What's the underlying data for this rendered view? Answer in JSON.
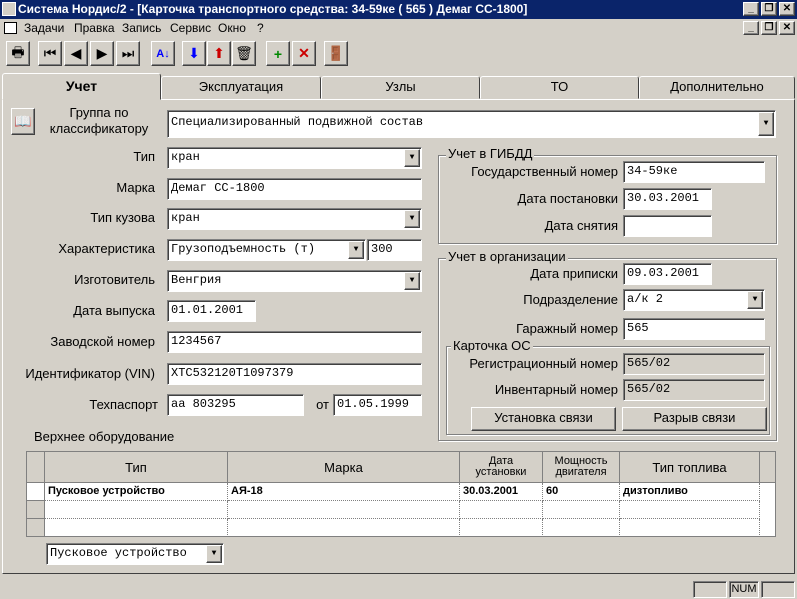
{
  "window": {
    "title": "Система Нордис/2 - [Карточка транспортного средства: 34-59ке ( 565 )  Демаг CC-1800]"
  },
  "menu": [
    "Задачи",
    "Правка",
    "Запись",
    "Сервис",
    "Окно",
    "?"
  ],
  "tabs": [
    "Учет",
    "Эксплуатация",
    "Узлы",
    "ТО",
    "Дополнительно"
  ],
  "form": {
    "group_label": "Группа по\nклассификатору",
    "group_value": "Специализированный подвижной состав",
    "type_label": "Тип",
    "type_value": "кран",
    "brand_label": "Марка",
    "brand_value": "Демаг CC-1800",
    "body_label": "Тип кузова",
    "body_value": "кран",
    "char_label": "Характеристика",
    "char_value": "Грузоподъемность (т)",
    "char_num": "300",
    "maker_label": "Изготовитель",
    "maker_value": "Венгрия",
    "release_label": "Дата выпуска",
    "release_value": "01.01.2001",
    "factory_label": "Заводской номер",
    "factory_value": "1234567",
    "vin_label": "Идентификатор (VIN)",
    "vin_value": "XTC532120T1097379",
    "passport_label": "Техпаспорт",
    "passport_value": "аа 803295",
    "from_label": "от",
    "from_value": "01.05.1999"
  },
  "gibdd": {
    "title": "Учет в ГИБДД",
    "plate_label": "Государственный номер",
    "plate_value": "34-59ке",
    "reg_label": "Дата постановки",
    "reg_value": "30.03.2001",
    "dereg_label": "Дата снятия",
    "dereg_value": ""
  },
  "org": {
    "title": "Учет в организации",
    "assign_label": "Дата приписки",
    "assign_value": "09.03.2001",
    "dept_label": "Подразделение",
    "dept_value": "а/к 2",
    "garage_label": "Гаражный номер",
    "garage_value": "565"
  },
  "os": {
    "title": "Карточка ОС",
    "regnum_label": "Регистрационный номер",
    "regnum_value": "565/02",
    "invnum_label": "Инвентарный номер",
    "invnum_value": "565/02",
    "link_button": "Установка связи",
    "unlink_button": "Разрыв связи"
  },
  "equipment": {
    "title": "Верхнее оборудование",
    "headers": [
      "Тип",
      "Марка",
      "Дата\nустановки",
      "Мощность\nдвигателя",
      "Тип топлива"
    ],
    "rows": [
      [
        "Пусковое устройство",
        "АЯ-18",
        "30.03.2001",
        "60",
        "дизтопливо"
      ]
    ],
    "filter_value": "Пусковое устройство"
  },
  "status": {
    "num": "NUM"
  },
  "colors": {
    "titlebar": "#0a246a",
    "face": "#d4d0c8"
  }
}
